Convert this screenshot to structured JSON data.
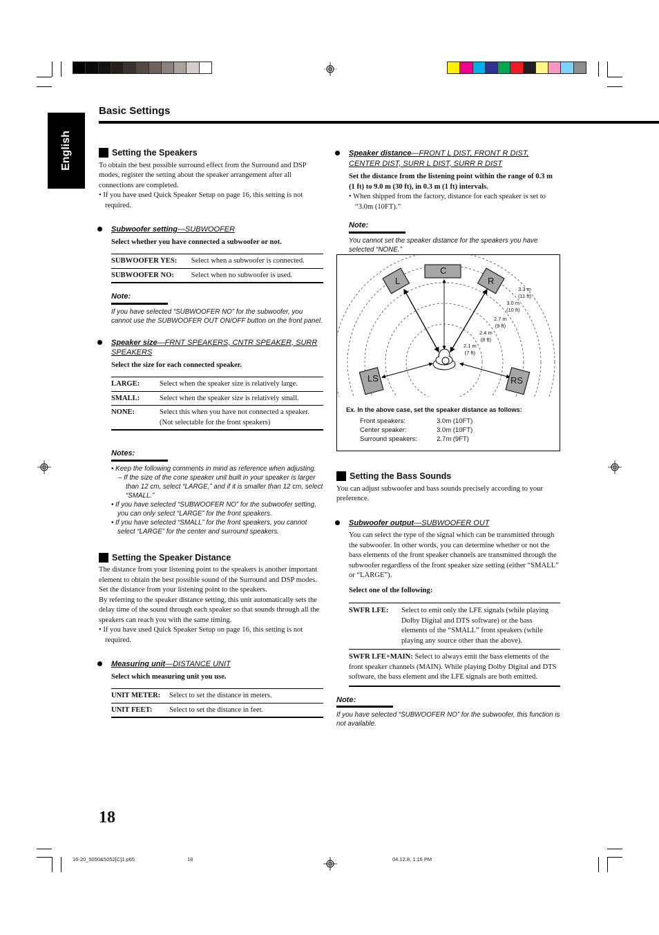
{
  "print_marks": {
    "gray_swatches": [
      "#000000",
      "#0a0a0a",
      "#141212",
      "#221f1d",
      "#3a3230",
      "#524846",
      "#6c6260",
      "#8a8280",
      "#a9a2a1",
      "#d4cccb",
      "#ffffff"
    ],
    "color_swatches": [
      "#fff100",
      "#ec008c",
      "#00aeef",
      "#2e3192",
      "#00a651",
      "#ed1c24",
      "#231f20",
      "#fff685",
      "#f49ac1",
      "#7dd3f7",
      "#8e8c8c"
    ]
  },
  "header": {
    "language_tab": "English",
    "title": "Basic Settings"
  },
  "left": {
    "speakers": {
      "heading": "Setting the Speakers",
      "intro": "To obtain the best possible surround effect from the Surround and DSP modes, register the setting about the speaker arrangement after all connections are completed.",
      "bullet": "• If you have used Quick Speaker Setup on page 16, this setting is not required."
    },
    "subwoofer": {
      "title": "Subwoofer setting",
      "code": "—SUBWOOFER",
      "instruction": "Select whether you have connected a subwoofer or not.",
      "options": [
        {
          "key": "SUBWOOFER YES:",
          "desc": "Select when a subwoofer is connected."
        },
        {
          "key": "SUBWOOFER NO:",
          "desc": "Select when no subwoofer is used."
        }
      ],
      "note_label": "Note:",
      "note": "If you have selected “SUBWOOFER NO” for the subwoofer, you cannot use the SUBWOOFER OUT ON/OFF button on the front panel."
    },
    "size": {
      "title": "Speaker size",
      "code": "—FRNT SPEAKERS, CNTR SPEAKER, SURR SPEAKERS",
      "instruction": "Select the size for each connected speaker.",
      "options": [
        {
          "key": "LARGE:",
          "desc": "Select when the speaker size is relatively large."
        },
        {
          "key": "SMALL:",
          "desc": "Select when the speaker size is relatively small."
        },
        {
          "key": "NONE:",
          "desc": "Select this when you have not connected a speaker. (Not selectable for the front speakers)"
        }
      ],
      "notes_label": "Notes:",
      "notes": [
        "Keep the following comments in mind as reference when adjusting.",
        "If the size of the cone speaker unit built in your speaker is larger than 12 cm, select “LARGE,” and if it is smaller than 12 cm, select “SMALL.”",
        "If you have selected “SUBWOOFER NO” for the subwoofer setting, you can only select “LARGE” for the front speakers.",
        "If you have selected “SMALL” for the front speakers, you cannot select “LARGE” for the center and surround speakers."
      ]
    },
    "distance": {
      "heading": "Setting the Speaker Distance",
      "p1": "The distance from your listening point to the speakers is another important element to obtain the best possible sound of the Surround and DSP modes. Set the distance from your listening point to the speakers.",
      "p2": "By referring to the speaker distance setting, this unit automatically sets the delay time of the sound through each speaker so that sounds through all the speakers can reach you with the same timing.",
      "bullet": "• If you have used Quick Speaker Setup on page 16, this setting is not required."
    },
    "unit": {
      "title": "Measuring unit",
      "code": "—DISTANCE UNIT",
      "instruction": "Select which measuring unit you use.",
      "options": [
        {
          "key": "UNIT METER:",
          "desc": "Select to set the distance in meters."
        },
        {
          "key": "UNIT FEET:",
          "desc": "Select to set the distance in feet."
        }
      ]
    }
  },
  "right": {
    "spk_distance": {
      "title": "Speaker distance",
      "code": "—FRONT L DIST, FRONT R DIST, CENTER DIST, SURR L DIST, SURR R DIST",
      "instruction": "Set the distance from the listening point within the range of 0.3 m (1 ft) to 9.0 m (30 ft), in 0.3 m (1 ft) intervals.",
      "bullet": "• When shipped from the factory, distance for each speaker is set to “3.0m (10FT).”",
      "note_label": "Note:",
      "note": "You cannot set the speaker distance for the speakers you have selected “NONE.”"
    },
    "diagram": {
      "speakers": [
        "L",
        "C",
        "R",
        "LS",
        "RS"
      ],
      "rings": [
        {
          "m": "2.1 m",
          "ft": "(7 ft)"
        },
        {
          "m": "2.4 m",
          "ft": "(8 ft)"
        },
        {
          "m": "2.7 m",
          "ft": "(9 ft)"
        },
        {
          "m": "3.0 m",
          "ft": "(10 ft)"
        },
        {
          "m": "3.3 m",
          "ft": "(11 ft)"
        }
      ],
      "example_title": "Ex. In the above case, set the speaker distance as follows:",
      "example_rows": [
        {
          "label": "Front speakers:",
          "value": "3.0m (10FT)"
        },
        {
          "label": "Center speaker:",
          "value": "3.0m (10FT)"
        },
        {
          "label": "Surround speakers:",
          "value": "2.7m (9FT)"
        }
      ]
    },
    "bass": {
      "heading": "Setting the Bass Sounds",
      "intro": "You can adjust subwoofer and bass sounds precisely according to your preference.",
      "title": "Subwoofer output",
      "code": "—SUBWOOFER OUT",
      "body": "You can select the type of the signal which can be transmitted through the subwoofer. In other words, you can determine whether or not the bass elements of the front speaker channels are transmitted through the subwoofer regardless of the front speaker size setting (either “SMALL” or “LARGE”).",
      "instruction": "Select one of the following:",
      "options": [
        {
          "key": "SWFR LFE:",
          "desc": "Select to emit only the LFE signals (while playing Dolby Digital and DTS software) or the bass elements of the “SMALL” front speakers (while playing any source other than the above)."
        },
        {
          "key": "SWFR LFE+MAIN:",
          "desc": "Select to always emit the bass elements of the front speaker channels (MAIN). While playing Dolby Digital and DTS software, the bass element and the LFE signals are both emitted."
        }
      ],
      "note_label": "Note:",
      "note": "If you have selected “SUBWOOFER NO” for the subwoofer, this function is not available."
    }
  },
  "footer": {
    "page_number": "18",
    "file_name": "16-20_5050&5052[C]1.p65",
    "file_page": "18",
    "timestamp": "04.12.8, 1:16 PM"
  }
}
